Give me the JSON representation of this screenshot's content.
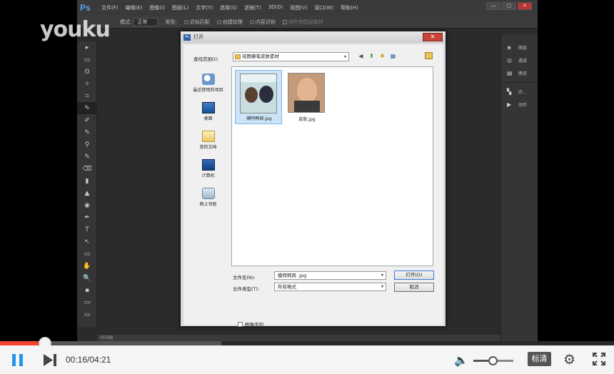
{
  "watermark": "youku",
  "photoshop": {
    "logo": "Ps",
    "menus": [
      "文件(F)",
      "编辑(E)",
      "图像(I)",
      "图层(L)",
      "文字(Y)",
      "选择(S)",
      "滤镜(T)",
      "3D(D)",
      "视图(V)",
      "窗口(W)",
      "帮助(H)"
    ],
    "window_buttons": [
      "—",
      "▢",
      "✕"
    ],
    "options": {
      "mode_label": "模式:",
      "mode_value": "正常",
      "type_label": "类型:",
      "proximity": "近似匹配",
      "create_texture": "创建纹理",
      "content_aware": "内容识别",
      "sample_all": "对所有图层取样"
    },
    "tools": [
      "▸",
      "▭",
      "ʘ",
      "✧",
      "⌗",
      "✎",
      "✐",
      "✎",
      "⚲",
      "✎",
      "⌫",
      "▮",
      "▲",
      "◉",
      "✒",
      "T",
      "↖",
      "▭",
      "✋",
      "🔍",
      "▪",
      "▭",
      "▭"
    ],
    "right_panel": [
      {
        "icon": "◈",
        "label": "图层"
      },
      {
        "icon": "◎",
        "label": "通道"
      },
      {
        "icon": "▤",
        "label": "路径"
      },
      {
        "icon": "▚",
        "label": "历..."
      },
      {
        "icon": "▶",
        "label": "动作"
      }
    ],
    "status": "时间轴"
  },
  "dialog": {
    "title": "打开",
    "close_label": "✕",
    "look_in_label": "查找范围(I):",
    "look_in_value": "绍图藤笔皮肤素材",
    "places": [
      {
        "icon": "recent",
        "label": "最近使用的项目"
      },
      {
        "icon": "desktop",
        "label": "桌面"
      },
      {
        "icon": "docs",
        "label": "我的文档"
      },
      {
        "icon": "computer",
        "label": "计算机"
      },
      {
        "icon": "network",
        "label": "网上邻居"
      }
    ],
    "files": [
      {
        "name": "模特韩周.jpg",
        "selected": true
      },
      {
        "name": "皮肤.jpg",
        "selected": false
      }
    ],
    "filename_label": "文件名(N):",
    "filename_value": "模特韩周 .jpg",
    "filetype_label": "文件类型(T):",
    "filetype_value": "所有格式",
    "open_button": "打开(O)",
    "cancel_button": "取消",
    "image_sequence": "图像序列"
  },
  "player": {
    "time": "00:16/04:21",
    "progress": 0.073,
    "buffered": 0.36,
    "volume": 0.5,
    "quality": "标清",
    "accent": "#f74232",
    "play_color": "#2596e8"
  }
}
